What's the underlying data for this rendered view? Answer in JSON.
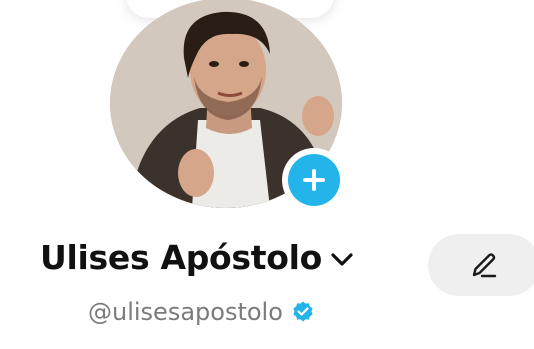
{
  "profile": {
    "display_name": "Ulises Apóstolo",
    "handle": "@ulisesapostolo",
    "verified": true
  },
  "icons": {
    "add": "plus-icon",
    "dropdown": "chevron-down-icon",
    "verified": "verified-badge-icon",
    "edit": "pencil-icon"
  },
  "colors": {
    "accent": "#23b4ea",
    "text_primary": "#111111",
    "text_secondary": "#7b7b7b",
    "button_bg": "#efefef"
  }
}
